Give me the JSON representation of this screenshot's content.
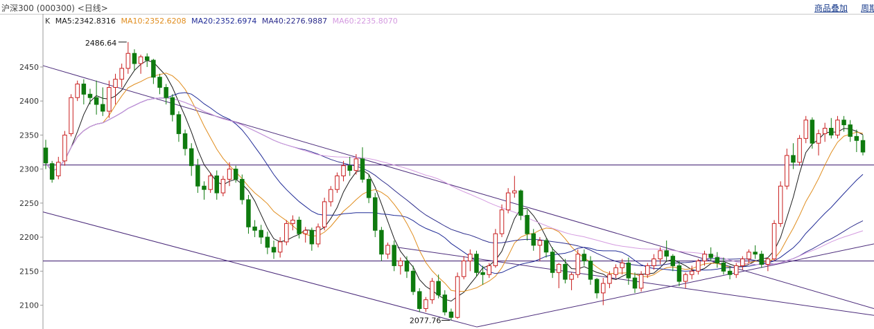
{
  "header": {
    "title": "沪深300 (000300) <日线>",
    "link_1": "商品叠加",
    "link_2": "周期"
  },
  "legend": {
    "k_label": "K",
    "ma5": "MA5:2342.8316",
    "ma10": "MA10:2352.6208",
    "ma20": "MA20:2352.6974",
    "ma40": "MA40:2276.9887",
    "ma60": "MA60:2235.8070"
  },
  "colors": {
    "up": "#c81c1c",
    "down": "#0e7a0e",
    "ma5": "#1a1a1a",
    "ma10": "#e08c1c",
    "ma20": "#1f2a96",
    "ma40": "#2c2c8c",
    "ma60": "#d49ae0",
    "trendline": "#4a2a7a"
  },
  "chart_data": {
    "type": "candlestick",
    "yaxis_ticks": [
      2100,
      2150,
      2200,
      2250,
      2300,
      2350,
      2400,
      2450
    ],
    "ylim": [
      2065,
      2520
    ],
    "annotations": [
      {
        "text": "2486.64",
        "value": 2486.64
      },
      {
        "text": "2077.76",
        "value": 2077.76
      }
    ],
    "horizontal_lines": [
      2306,
      2165
    ],
    "trend_lines": [
      {
        "from": [
          0,
          2452
        ],
        "to": [
          293,
          2095
        ]
      },
      {
        "from": [
          0,
          2237
        ],
        "to": [
          153,
          2068
        ]
      },
      {
        "from": [
          153,
          2068
        ],
        "to": [
          293,
          2190
        ]
      },
      {
        "from": [
          125,
          2185
        ],
        "to": [
          293,
          2085
        ]
      }
    ],
    "ohlc": [
      [
        2331,
        2343,
        2300,
        2309
      ],
      [
        2308,
        2312,
        2280,
        2285
      ],
      [
        2290,
        2318,
        2285,
        2310
      ],
      [
        2312,
        2356,
        2305,
        2350
      ],
      [
        2352,
        2410,
        2348,
        2405
      ],
      [
        2405,
        2430,
        2400,
        2425
      ],
      [
        2425,
        2432,
        2395,
        2410
      ],
      [
        2410,
        2418,
        2395,
        2405
      ],
      [
        2405,
        2430,
        2380,
        2395
      ],
      [
        2395,
        2420,
        2378,
        2385
      ],
      [
        2385,
        2430,
        2375,
        2420
      ],
      [
        2420,
        2440,
        2395,
        2432
      ],
      [
        2432,
        2455,
        2420,
        2448
      ],
      [
        2448,
        2486.64,
        2440,
        2470
      ],
      [
        2470,
        2476,
        2445,
        2455
      ],
      [
        2455,
        2468,
        2440,
        2465
      ],
      [
        2465,
        2470,
        2450,
        2460
      ],
      [
        2460,
        2462,
        2425,
        2435
      ],
      [
        2435,
        2440,
        2410,
        2420
      ],
      [
        2420,
        2425,
        2395,
        2405
      ],
      [
        2405,
        2410,
        2370,
        2380
      ],
      [
        2380,
        2385,
        2340,
        2352
      ],
      [
        2352,
        2358,
        2320,
        2330
      ],
      [
        2330,
        2338,
        2290,
        2305
      ],
      [
        2305,
        2315,
        2265,
        2275
      ],
      [
        2275,
        2282,
        2255,
        2270
      ],
      [
        2270,
        2295,
        2265,
        2290
      ],
      [
        2290,
        2298,
        2255,
        2265
      ],
      [
        2265,
        2290,
        2260,
        2285
      ],
      [
        2285,
        2310,
        2275,
        2300
      ],
      [
        2300,
        2305,
        2280,
        2285
      ],
      [
        2285,
        2292,
        2248,
        2255
      ],
      [
        2255,
        2262,
        2205,
        2215
      ],
      [
        2215,
        2225,
        2200,
        2210
      ],
      [
        2210,
        2218,
        2190,
        2200
      ],
      [
        2200,
        2208,
        2175,
        2185
      ],
      [
        2185,
        2195,
        2168,
        2178
      ],
      [
        2178,
        2200,
        2170,
        2193
      ],
      [
        2193,
        2225,
        2188,
        2220
      ],
      [
        2220,
        2232,
        2210,
        2225
      ],
      [
        2225,
        2230,
        2198,
        2205
      ],
      [
        2205,
        2215,
        2192,
        2210
      ],
      [
        2210,
        2214,
        2180,
        2190
      ],
      [
        2190,
        2220,
        2185,
        2215
      ],
      [
        2215,
        2258,
        2210,
        2252
      ],
      [
        2252,
        2275,
        2245,
        2270
      ],
      [
        2270,
        2295,
        2265,
        2290
      ],
      [
        2290,
        2312,
        2282,
        2305
      ],
      [
        2305,
        2318,
        2290,
        2298
      ],
      [
        2298,
        2322,
        2292,
        2315
      ],
      [
        2315,
        2332,
        2280,
        2285
      ],
      [
        2285,
        2292,
        2250,
        2258
      ],
      [
        2258,
        2265,
        2200,
        2210
      ],
      [
        2210,
        2215,
        2165,
        2175
      ],
      [
        2175,
        2192,
        2168,
        2188
      ],
      [
        2188,
        2195,
        2150,
        2158
      ],
      [
        2158,
        2170,
        2145,
        2165
      ],
      [
        2165,
        2172,
        2140,
        2150
      ],
      [
        2150,
        2158,
        2115,
        2120
      ],
      [
        2120,
        2125,
        2090,
        2095
      ],
      [
        2095,
        2112,
        2090,
        2108
      ],
      [
        2108,
        2140,
        2102,
        2135
      ],
      [
        2135,
        2145,
        2110,
        2115
      ],
      [
        2115,
        2122,
        2085,
        2090
      ],
      [
        2090,
        2095,
        2077.76,
        2082
      ],
      [
        2082,
        2148,
        2080,
        2142
      ],
      [
        2142,
        2172,
        2138,
        2165
      ],
      [
        2165,
        2182,
        2150,
        2175
      ],
      [
        2175,
        2180,
        2142,
        2148
      ],
      [
        2148,
        2158,
        2130,
        2145
      ],
      [
        2145,
        2162,
        2140,
        2158
      ],
      [
        2158,
        2212,
        2155,
        2205
      ],
      [
        2205,
        2248,
        2200,
        2240
      ],
      [
        2240,
        2272,
        2235,
        2265
      ],
      [
        2265,
        2290,
        2258,
        2268
      ],
      [
        2268,
        2270,
        2225,
        2232
      ],
      [
        2232,
        2240,
        2195,
        2205
      ],
      [
        2205,
        2212,
        2180,
        2188
      ],
      [
        2188,
        2200,
        2165,
        2195
      ],
      [
        2195,
        2198,
        2170,
        2178
      ],
      [
        2178,
        2185,
        2140,
        2148
      ],
      [
        2148,
        2162,
        2125,
        2160
      ],
      [
        2160,
        2168,
        2132,
        2138
      ],
      [
        2138,
        2148,
        2122,
        2145
      ],
      [
        2145,
        2182,
        2140,
        2175
      ],
      [
        2175,
        2182,
        2158,
        2165
      ],
      [
        2165,
        2172,
        2130,
        2138
      ],
      [
        2138,
        2140,
        2110,
        2118
      ],
      [
        2118,
        2140,
        2100,
        2132
      ],
      [
        2132,
        2150,
        2125,
        2145
      ],
      [
        2145,
        2160,
        2140,
        2155
      ],
      [
        2155,
        2168,
        2145,
        2162
      ],
      [
        2162,
        2170,
        2130,
        2140
      ],
      [
        2140,
        2148,
        2118,
        2125
      ],
      [
        2125,
        2150,
        2120,
        2145
      ],
      [
        2145,
        2162,
        2140,
        2158
      ],
      [
        2158,
        2175,
        2152,
        2168
      ],
      [
        2168,
        2185,
        2160,
        2180
      ],
      [
        2180,
        2195,
        2165,
        2172
      ],
      [
        2172,
        2175,
        2150,
        2158
      ],
      [
        2158,
        2165,
        2128,
        2135
      ],
      [
        2135,
        2148,
        2125,
        2145
      ],
      [
        2145,
        2158,
        2138,
        2150
      ],
      [
        2150,
        2168,
        2145,
        2165
      ],
      [
        2165,
        2180,
        2158,
        2175
      ],
      [
        2175,
        2185,
        2165,
        2170
      ],
      [
        2170,
        2178,
        2155,
        2162
      ],
      [
        2162,
        2170,
        2145,
        2150
      ],
      [
        2150,
        2158,
        2138,
        2145
      ],
      [
        2145,
        2162,
        2140,
        2158
      ],
      [
        2158,
        2172,
        2152,
        2168
      ],
      [
        2168,
        2182,
        2162,
        2178
      ],
      [
        2178,
        2188,
        2168,
        2175
      ],
      [
        2175,
        2180,
        2155,
        2160
      ],
      [
        2160,
        2170,
        2150,
        2168
      ],
      [
        2168,
        2225,
        2165,
        2220
      ],
      [
        2220,
        2282,
        2215,
        2275
      ],
      [
        2275,
        2330,
        2270,
        2320
      ],
      [
        2320,
        2338,
        2300,
        2310
      ],
      [
        2310,
        2350,
        2305,
        2345
      ],
      [
        2345,
        2378,
        2338,
        2372
      ],
      [
        2372,
        2376,
        2330,
        2338
      ],
      [
        2338,
        2358,
        2320,
        2352
      ],
      [
        2352,
        2368,
        2340,
        2360
      ],
      [
        2360,
        2375,
        2345,
        2350
      ],
      [
        2350,
        2378,
        2345,
        2372
      ],
      [
        2372,
        2378,
        2355,
        2365
      ],
      [
        2365,
        2372,
        2340,
        2348
      ],
      [
        2348,
        2358,
        2325,
        2342
      ],
      [
        2342,
        2350,
        2320,
        2325
      ]
    ]
  }
}
